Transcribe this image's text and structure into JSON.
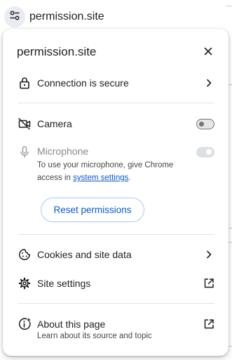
{
  "omnibox": {
    "url": "permission.site",
    "site_info_icon": "tune-icon"
  },
  "bubble": {
    "title": "permission.site",
    "close_icon": "close-icon",
    "connection": {
      "label": "Connection is secure",
      "icon": "lock-icon"
    },
    "camera": {
      "label": "Camera",
      "icon": "camera-off-icon",
      "toggle_on": false
    },
    "microphone": {
      "label": "Microphone",
      "icon": "microphone-icon",
      "toggle_on": true,
      "toggle_disabled": true,
      "note_prefix": "To use your microphone, give Chrome access in ",
      "note_link": "system settings",
      "note_suffix": "."
    },
    "reset_button": "Reset permissions",
    "cookies": {
      "label": "Cookies and site data",
      "icon": "cookie-icon"
    },
    "site_settings": {
      "label": "Site settings",
      "icon": "gear-icon"
    },
    "about": {
      "label": "About this page",
      "sublabel": "Learn about its source and topic",
      "icon": "about-page-icon"
    }
  },
  "colors": {
    "accent": "#0b57d0",
    "separator": "#dbe4ef",
    "text": "#1f1f1f",
    "secondary_text": "#444746",
    "disabled_text": "#8a8a8a"
  }
}
